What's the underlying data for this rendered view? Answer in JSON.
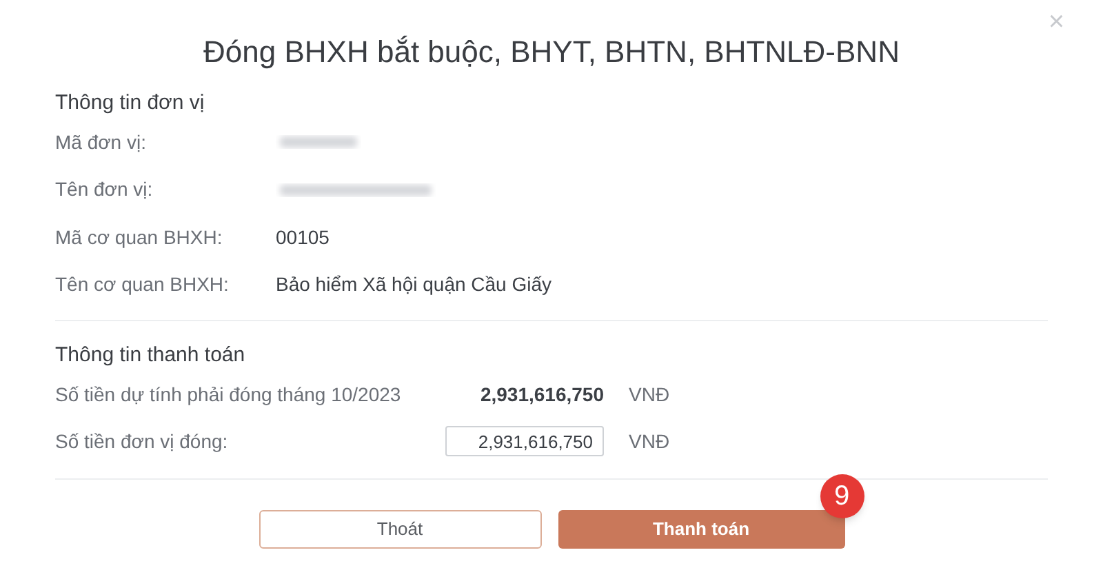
{
  "dialog": {
    "title": "Đóng BHXH bắt buộc, BHYT, BHTN, BHTNLĐ-BNN",
    "close": "×"
  },
  "unit_info": {
    "heading": "Thông tin đơn vị",
    "rows": [
      {
        "label": "Mã đơn vị:",
        "kind": "redacted"
      },
      {
        "label": "Tên đơn vị:",
        "kind": "redacted"
      },
      {
        "label": "Mã cơ quan BHXH:",
        "kind": "text",
        "value": "00105"
      },
      {
        "label": "Tên cơ quan BHXH:",
        "kind": "text",
        "value": "Bảo hiểm Xã hội quận Cầu Giấy"
      }
    ]
  },
  "payment_info": {
    "heading": "Thông tin thanh toán",
    "rows": [
      {
        "label": "Số tiền dự tính phải đóng tháng 10/2023",
        "kind": "text",
        "value": "2,931,616,750",
        "unit": "VNĐ"
      },
      {
        "label": "Số tiền đơn vị đóng:",
        "kind": "input",
        "value": "2,931,616,750",
        "unit": "VNĐ"
      }
    ]
  },
  "buttons": [
    {
      "label": "Thoát",
      "kind": "secondary"
    },
    {
      "label": "Thanh toán",
      "kind": "primary",
      "badge": "9"
    }
  ]
}
